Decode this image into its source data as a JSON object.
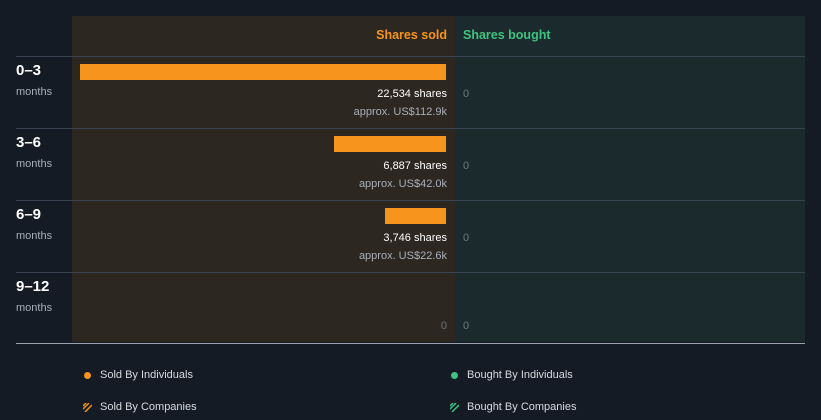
{
  "colors": {
    "sold": "#f7941d",
    "bought": "#3fc380",
    "background": "#151b24",
    "sold_panel": "#2d2722",
    "bought_panel": "#1b2b2d"
  },
  "headers": {
    "sold": "Shares sold",
    "bought": "Shares bought"
  },
  "chart_data": {
    "type": "bar",
    "orientation": "horizontal",
    "categories": [
      "0–3",
      "3–6",
      "6–9",
      "9–12"
    ],
    "category_unit": "months",
    "series": [
      {
        "name": "Shares sold",
        "values": [
          22534,
          6887,
          3746,
          0
        ],
        "value_labels": [
          "22,534 shares",
          "6,887 shares",
          "3,746 shares",
          "0"
        ],
        "approx_labels": [
          "approx. US$112.9k",
          "approx. US$42.0k",
          "approx. US$22.6k",
          ""
        ]
      },
      {
        "name": "Shares bought",
        "values": [
          0,
          0,
          0,
          0
        ],
        "value_labels": [
          "0",
          "0",
          "0",
          "0"
        ]
      }
    ]
  },
  "legend": [
    {
      "label": "Sold By Individuals",
      "icon": "dot",
      "color": "#f7941d"
    },
    {
      "label": "Bought By Individuals",
      "icon": "dot",
      "color": "#3fc380"
    },
    {
      "label": "Sold By Companies",
      "icon": "hatch",
      "color": "#f7941d"
    },
    {
      "label": "Bought By Companies",
      "icon": "hatch",
      "color": "#3fc380"
    }
  ]
}
